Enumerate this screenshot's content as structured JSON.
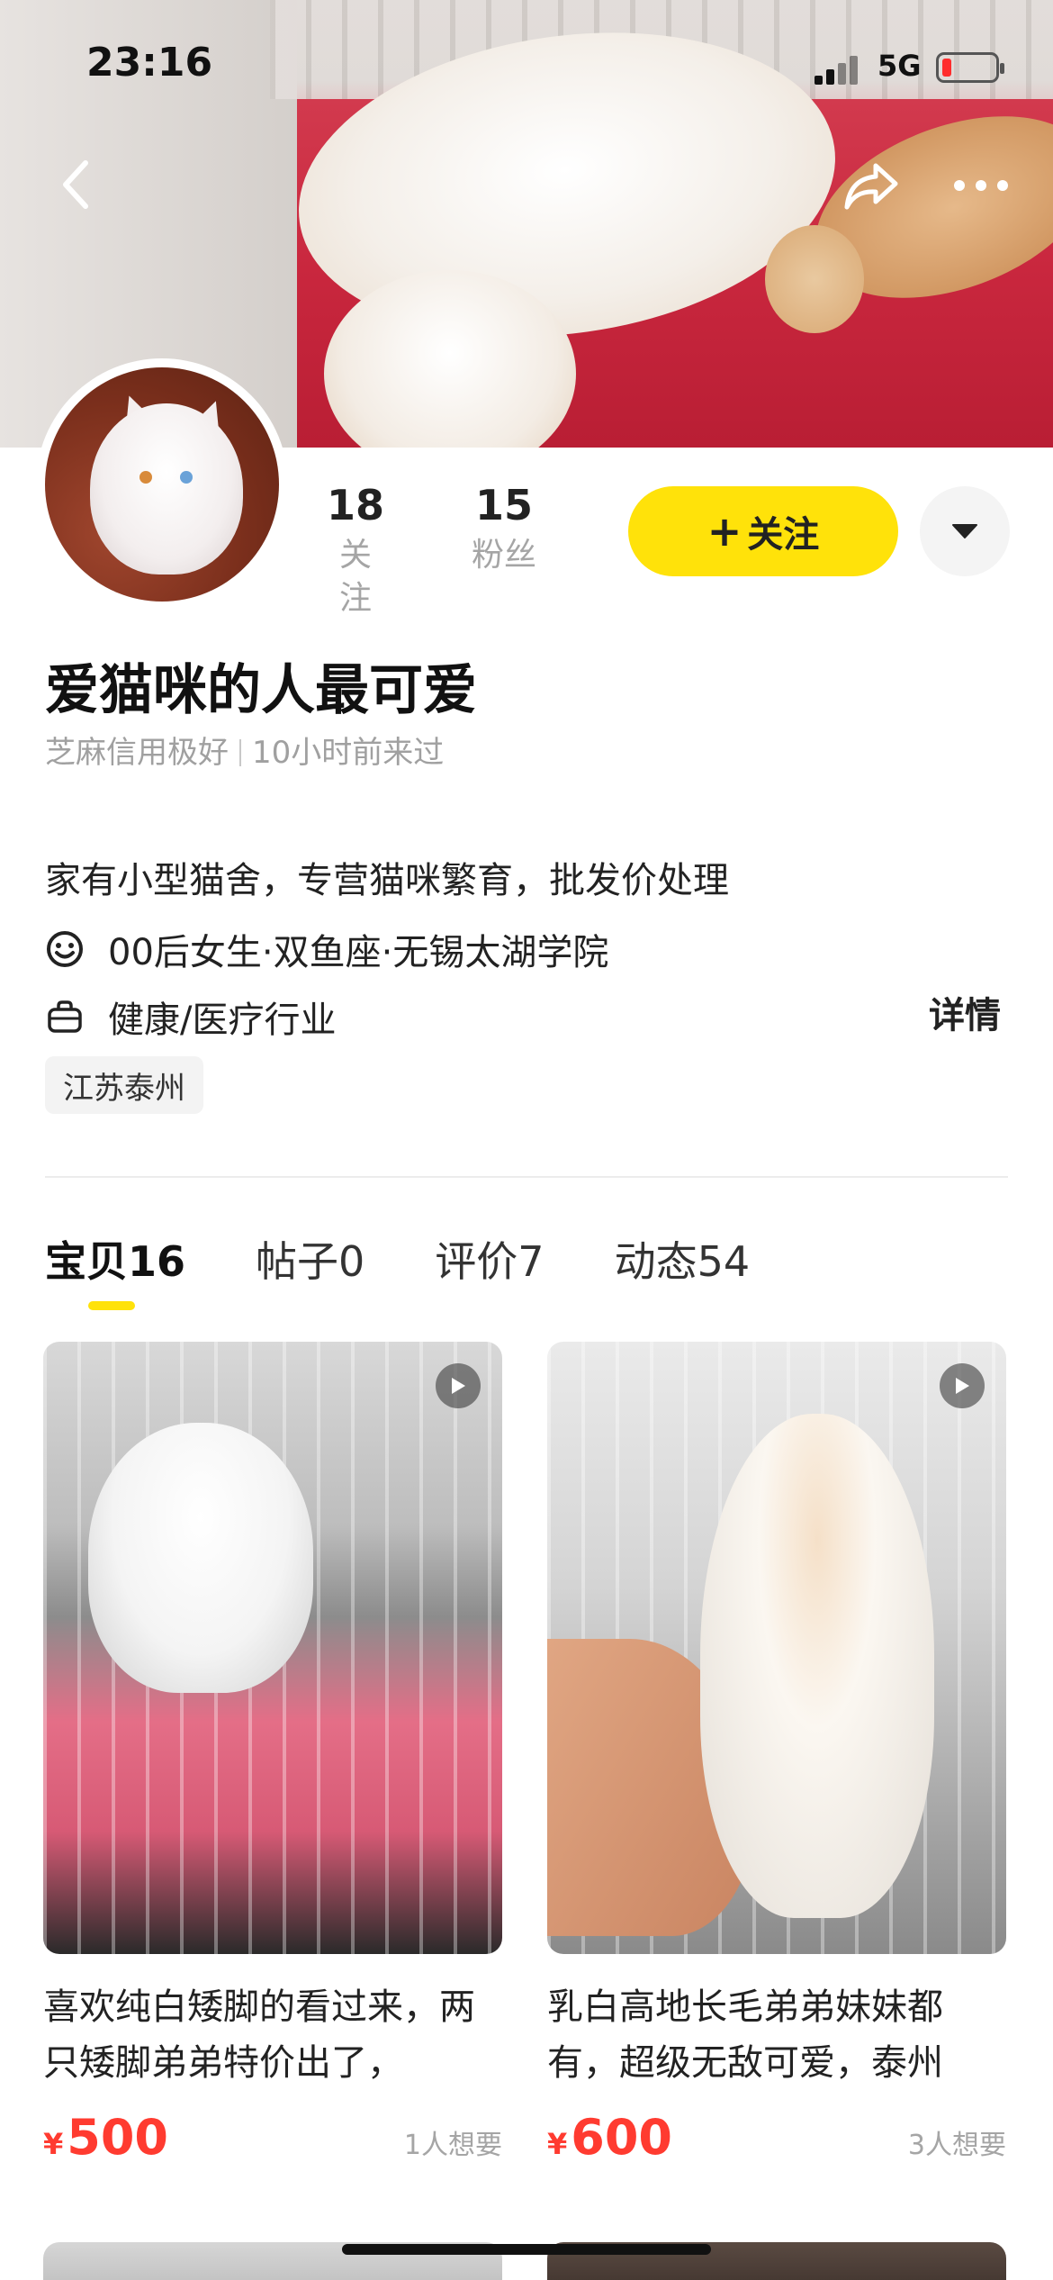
{
  "status_bar": {
    "time": "23:16",
    "network": "5G"
  },
  "profile": {
    "following_count": "18",
    "following_label": "关注",
    "fans_count": "15",
    "fans_label": "粉丝",
    "follow_button_plus": "+",
    "follow_button_label": "关注",
    "name": "爱猫咪的人最可爱",
    "credit": "芝麻信用极好",
    "last_seen": "10小时前来过",
    "bio": "家有小型猫舍，专营猫咪繁育，批发价处理",
    "tags": "00后女生·双鱼座·无锡太湖学院",
    "industry": "健康/医疗行业",
    "detail_link": "详情",
    "location": "江苏泰州"
  },
  "tabs": [
    {
      "label": "宝贝",
      "count": "16",
      "active": true
    },
    {
      "label": "帖子",
      "count": "0",
      "active": false
    },
    {
      "label": "评价",
      "count": "7",
      "active": false
    },
    {
      "label": "动态",
      "count": "54",
      "active": false
    }
  ],
  "items": [
    {
      "title": "喜欢纯白矮脚的看过来，两只矮脚弟弟特价出了，",
      "currency": "¥",
      "price": "500",
      "wants": "1人想要"
    },
    {
      "title": "乳白高地长毛弟弟妹妹都有，超级无敌可爱，泰州",
      "currency": "¥",
      "price": "600",
      "wants": "3人想要"
    }
  ],
  "colors": {
    "accent": "#ffe20a",
    "price": "#ff3b30",
    "muted": "#a5a5a5"
  },
  "icons": [
    "back-icon",
    "share-icon",
    "more-icon",
    "dropdown-icon",
    "smile-icon",
    "briefcase-icon",
    "play-icon"
  ]
}
